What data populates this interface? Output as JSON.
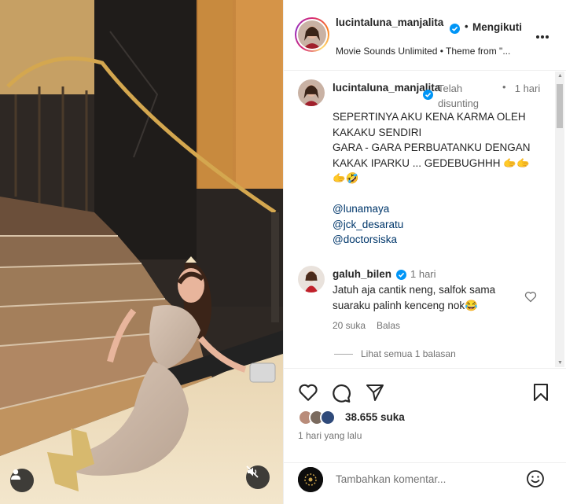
{
  "post": {
    "header": {
      "username": "lucintaluna_manjalita",
      "dot": "•",
      "follow_label": "Mengikuti",
      "audio_line": "Movie Sounds Unlimited • Theme from \"...",
      "more_icon": "more-horizontal-icon"
    },
    "caption": {
      "username": "lucintaluna_manjalita",
      "edited_label": "Telah disunting",
      "dot": "•",
      "time": "1 hari",
      "lines": [
        "SEPERTINYA AKU KENA KARMA OLEH",
        "KAKAKU SENDIRI",
        "GARA - GARA PERBUATANKU DENGAN",
        "KAKAK IPARKU ... GEDEBUGHHH 🫱🫱",
        "🫱🤣"
      ],
      "mentions": [
        "@lunamaya",
        "@jck_desaratu",
        "@doctorsiska"
      ]
    },
    "comment": {
      "username": "galuh_bilen",
      "time": "1 hari",
      "text": "Jatuh aja cantik neng, salfok sama suaraku palinh kenceng nok😂",
      "likes": "20 suka",
      "reply_label": "Balas",
      "view_replies": "Lihat semua 1 balasan"
    },
    "actions": {
      "likes_count": "38.655 suka",
      "time_ago": "1 hari yang lalu"
    },
    "add_comment": {
      "placeholder": "Tambahkan komentar..."
    }
  },
  "colors": {
    "verified": "#0095f6",
    "link": "#00376b",
    "muted_text": "#737373",
    "primary_text": "#262626"
  }
}
